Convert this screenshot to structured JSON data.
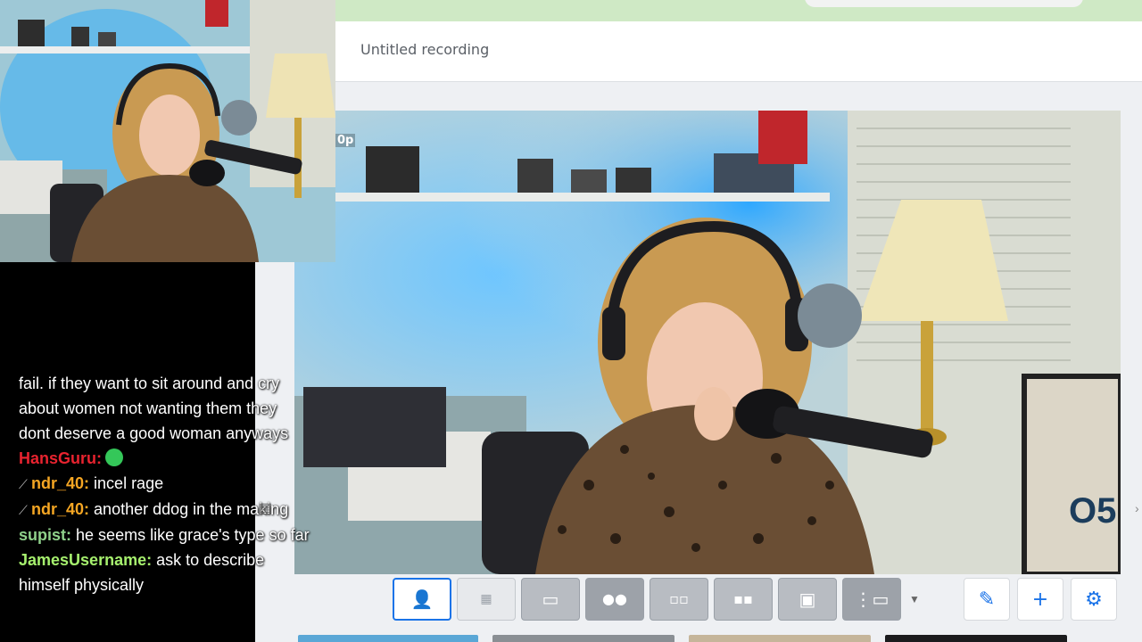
{
  "recording": {
    "title": "Untitled recording"
  },
  "video": {
    "resolution_tag": "0p"
  },
  "chat": {
    "lines": [
      {
        "user": "",
        "text": "fail. if they want to sit around and cry"
      },
      {
        "user": "",
        "text": "about women not wanting them they"
      },
      {
        "user": "",
        "text": "dont deserve a good woman anyways"
      },
      {
        "user": "HansGuru:",
        "user_color": "#e8232f",
        "text": "",
        "emote": "green-blob-emote"
      },
      {
        "user": "ndr_40:",
        "user_color": "#f5a623",
        "badge": "sword-badge",
        "text": "incel rage"
      },
      {
        "user": "ndr_40:",
        "user_color": "#f5a623",
        "badge": "sword-badge",
        "text": "another ddog in the making"
      },
      {
        "user": "supist:",
        "user_color": "#8fd18a",
        "text": "he seems like grace's type so far"
      },
      {
        "user": "JamesUsername:",
        "user_color": "#a6f06e",
        "text": "ask to describe"
      },
      {
        "user": "",
        "text": "himself physically"
      }
    ]
  },
  "layouts": [
    {
      "name": "single-speaker-layout",
      "icon": "person-icon",
      "active": true
    },
    {
      "name": "grid-four-layout",
      "icon": "grid-icon"
    },
    {
      "name": "speaker-plus-screen-layout",
      "icon": "screen-person-icon"
    },
    {
      "name": "two-person-split-layout",
      "icon": "two-people-icon"
    },
    {
      "name": "two-person-boxed-layout",
      "icon": "two-people-boxed-icon"
    },
    {
      "name": "two-person-panel-layout",
      "icon": "two-people-panel-icon"
    },
    {
      "name": "person-with-monitor-layout",
      "icon": "monitor-person-icon"
    },
    {
      "name": "list-with-screen-layout",
      "icon": "list-screen-icon"
    }
  ],
  "tools": {
    "edit_icon": "pencil-icon",
    "add_icon": "plus-icon",
    "settings_icon": "gear-icon"
  },
  "colors": {
    "accent": "#1a73e8",
    "topbar": "#cfe9c5"
  }
}
